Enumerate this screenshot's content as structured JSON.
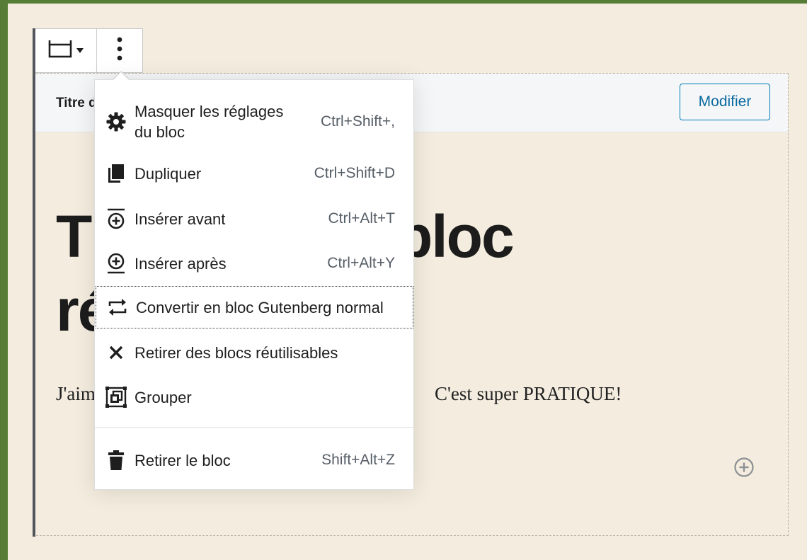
{
  "block": {
    "header_label": "Titre d",
    "modify_label": "Modifier",
    "title_left_line1": "T",
    "title_left_line2": "ré",
    "title_right": "bloc",
    "paragraph_left": "J'aim",
    "paragraph_right": "C'est super PRATIQUE!"
  },
  "toolbar": {
    "switcher_icon": "reusable-block-icon",
    "caret_icon": "caret-down-icon",
    "more_icon": "more-vertical-icon"
  },
  "menu": {
    "items": [
      {
        "label": "Masquer les réglages du bloc",
        "label_line1": "Masquer les réglages",
        "label_line2": "du bloc",
        "shortcut": "Ctrl+Shift+,",
        "icon": "gear-icon"
      },
      {
        "label": "Dupliquer",
        "shortcut": "Ctrl+Shift+D",
        "icon": "duplicate-icon"
      },
      {
        "label": "Insérer avant",
        "shortcut": "Ctrl+Alt+T",
        "icon": "insert-before-icon"
      },
      {
        "label": "Insérer après",
        "shortcut": "Ctrl+Alt+Y",
        "icon": "insert-after-icon"
      },
      {
        "label": "Convertir en bloc Gutenberg normal",
        "shortcut": "",
        "icon": "convert-icon"
      },
      {
        "label": "Retirer des blocs réutilisables",
        "shortcut": "",
        "icon": "close-icon"
      },
      {
        "label": "Grouper",
        "shortcut": "",
        "icon": "group-icon"
      },
      {
        "label": "Retirer le bloc",
        "shortcut": "Shift+Alt+Z",
        "icon": "trash-icon"
      }
    ]
  },
  "colors": {
    "frame_green": "#567d36",
    "canvas_beige": "#f4eddf",
    "accent_blue": "#007cba"
  }
}
